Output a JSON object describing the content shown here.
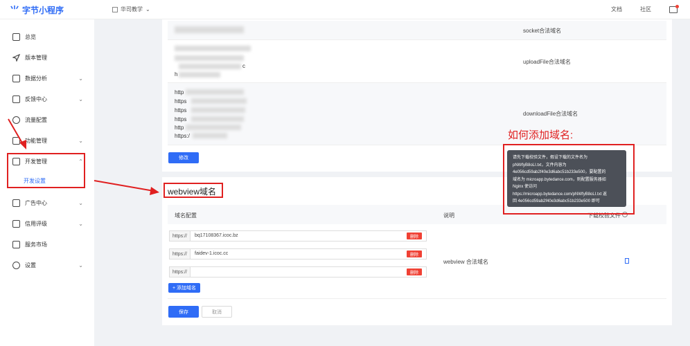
{
  "header": {
    "logo_mark": "⺌",
    "logo_text": "字节小程序",
    "app_name": "华司教学",
    "links": {
      "docs": "文档",
      "community": "社区"
    }
  },
  "sidebar": {
    "items": [
      {
        "label": "总览",
        "icon": "home-icon"
      },
      {
        "label": "版本管理",
        "icon": "send-icon"
      },
      {
        "label": "数据分析",
        "icon": "chart-icon"
      },
      {
        "label": "反馈中心",
        "icon": "message-icon"
      },
      {
        "label": "流量配置",
        "icon": "share-icon"
      },
      {
        "label": "功能管理",
        "icon": "cube-icon"
      },
      {
        "label": "开发管理",
        "icon": "code-icon"
      },
      {
        "label": "广告中心",
        "icon": "megaphone-icon"
      },
      {
        "label": "信用评级",
        "icon": "rating-icon"
      },
      {
        "label": "服务市场",
        "icon": "market-icon"
      },
      {
        "label": "设置",
        "icon": "gear-icon"
      }
    ],
    "active_sub": "开发设置"
  },
  "server_domains": {
    "rows": [
      {
        "desc": "socket合法域名"
      },
      {
        "desc": "uploadFile合法域名",
        "prefix_lines": [
          "",
          "",
          "c",
          "h"
        ]
      },
      {
        "desc": "downloadFile合法域名",
        "prefix_lines": [
          "http",
          "https",
          "https",
          "https",
          "http",
          "https:/"
        ]
      }
    ],
    "edit_button": "修改"
  },
  "webview": {
    "title": "webview域名",
    "col_domain": "域名配置",
    "col_desc": "说明",
    "col_file": "下载校验文件",
    "inputs": [
      {
        "prefix": "https://",
        "value": "bq17108367.icoc.bz",
        "delete": "删除"
      },
      {
        "prefix": "https://",
        "value": "faidev-1.icoc.cc",
        "delete": "删除"
      },
      {
        "prefix": "https://",
        "value": "",
        "delete": "删除"
      }
    ],
    "add_button": "+ 添加域名",
    "description": "webview 合法域名",
    "save_button": "保存",
    "cancel_button": "取消"
  },
  "annotation": "如何添加域名:",
  "tooltip": {
    "lines": [
      "请先下载校验文件，假设下载的文件名为",
      "pNWfyB8oLI.txt，文件内容为",
      "4e056cd59ab2f40e3d6abc51b233e500，要配置的",
      "域名为 microapp.bytedance.com，则配置服务器如",
      "Nginx 使访问",
      "https://microapp.bytedance.com/pNWfyB8oLI.txt 返",
      "回 4e056cd59ab2f40e3d6abc51b233e500 即可"
    ]
  },
  "colors": {
    "primary": "#2f6cf6",
    "danger": "#f04134",
    "annotation_red": "#e02020"
  }
}
